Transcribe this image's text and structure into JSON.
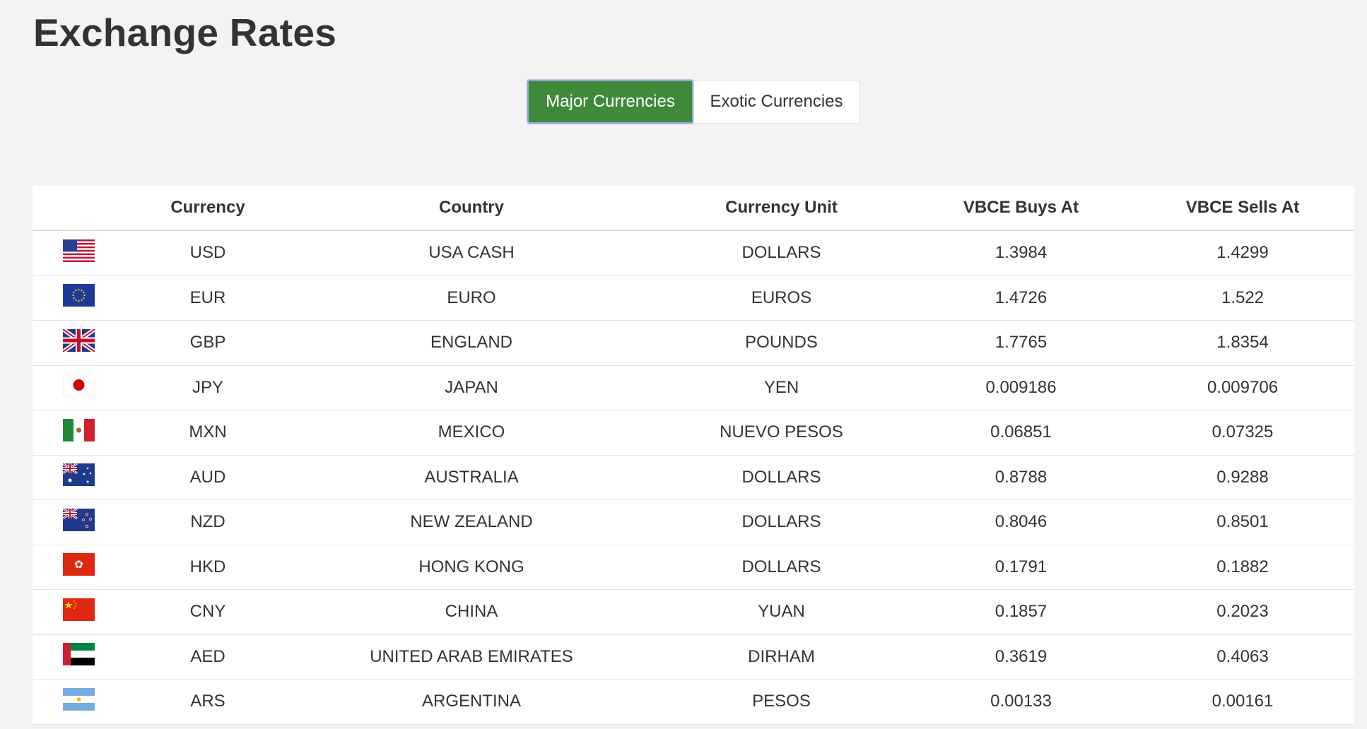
{
  "title": "Exchange Rates",
  "tabs": [
    {
      "label": "Major Currencies",
      "active": true
    },
    {
      "label": "Exotic Currencies",
      "active": false
    }
  ],
  "table": {
    "headers": [
      "",
      "Currency",
      "Country",
      "Currency Unit",
      "VBCE Buys At",
      "VBCE Sells At"
    ],
    "rows": [
      {
        "flag": "flag-usa-icon",
        "code": "USD",
        "country": "USA CASH",
        "unit": "DOLLARS",
        "buy": "1.3984",
        "sell": "1.4299"
      },
      {
        "flag": "flag-eu-icon",
        "code": "EUR",
        "country": "EURO",
        "unit": "EUROS",
        "buy": "1.4726",
        "sell": "1.522"
      },
      {
        "flag": "flag-uk-icon",
        "code": "GBP",
        "country": "ENGLAND",
        "unit": "POUNDS",
        "buy": "1.7765",
        "sell": "1.8354"
      },
      {
        "flag": "flag-japan-icon",
        "code": "JPY",
        "country": "JAPAN",
        "unit": "YEN",
        "buy": "0.009186",
        "sell": "0.009706"
      },
      {
        "flag": "flag-mexico-icon",
        "code": "MXN",
        "country": "MEXICO",
        "unit": "NUEVO PESOS",
        "buy": "0.06851",
        "sell": "0.07325"
      },
      {
        "flag": "flag-australia-icon",
        "code": "AUD",
        "country": "AUSTRALIA",
        "unit": "DOLLARS",
        "buy": "0.8788",
        "sell": "0.9288"
      },
      {
        "flag": "flag-new-zealand-icon",
        "code": "NZD",
        "country": "NEW ZEALAND",
        "unit": "DOLLARS",
        "buy": "0.8046",
        "sell": "0.8501"
      },
      {
        "flag": "flag-hong-kong-icon",
        "code": "HKD",
        "country": "HONG KONG",
        "unit": "DOLLARS",
        "buy": "0.1791",
        "sell": "0.1882"
      },
      {
        "flag": "flag-china-icon",
        "code": "CNY",
        "country": "CHINA",
        "unit": "YUAN",
        "buy": "0.1857",
        "sell": "0.2023"
      },
      {
        "flag": "flag-uae-icon",
        "code": "AED",
        "country": "UNITED ARAB EMIRATES",
        "unit": "DIRHAM",
        "buy": "0.3619",
        "sell": "0.4063"
      },
      {
        "flag": "flag-argentina-icon",
        "code": "ARS",
        "country": "ARGENTINA",
        "unit": "PESOS",
        "buy": "0.00133",
        "sell": "0.00161"
      }
    ]
  },
  "colors": {
    "accent": "#3f8a3a",
    "background": "#f3f3f3"
  }
}
